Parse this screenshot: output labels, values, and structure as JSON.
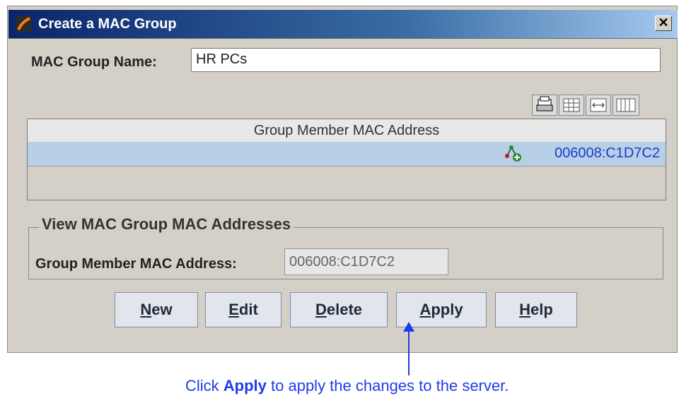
{
  "window": {
    "title": "Create a MAC Group",
    "close_symbol": "✕"
  },
  "form": {
    "group_name_label": "MAC Group Name:",
    "group_name_value": "HR PCs"
  },
  "toolbar": {
    "icons": [
      "printer-icon",
      "table-icon",
      "column-resize-icon",
      "columns-icon"
    ]
  },
  "table": {
    "header": "Group Member MAC Address",
    "rows": [
      {
        "mac": "006008:C1D7C2",
        "icon": "network-add-icon"
      }
    ]
  },
  "view_group": {
    "legend": "View MAC Group MAC Addresses",
    "member_label": "Group Member MAC Address:",
    "member_value": "006008:C1D7C2"
  },
  "buttons": {
    "new": {
      "mnemonic": "N",
      "rest": "ew"
    },
    "edit": {
      "mnemonic": "E",
      "rest": "dit"
    },
    "delete": {
      "mnemonic": "D",
      "rest": "elete"
    },
    "apply": {
      "mnemonic": "A",
      "rest": "pply"
    },
    "help": {
      "mnemonic": "H",
      "rest": "elp"
    }
  },
  "annotation": {
    "prefix": "Click ",
    "emphasis": "Apply",
    "suffix": " to apply the changes to the server."
  },
  "colors": {
    "accent": "#1f3ce6",
    "title_bar_start": "#0a246a",
    "selected_row": "#b8cfe8"
  }
}
